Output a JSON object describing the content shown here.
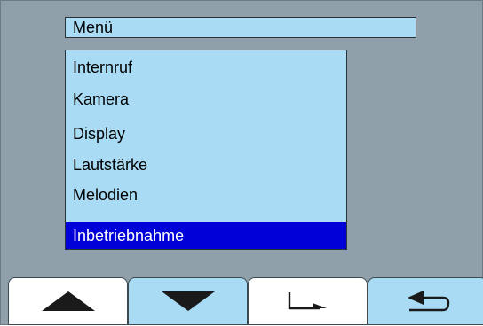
{
  "title": "Menü",
  "menu": {
    "items": [
      {
        "label": "Internruf",
        "selected": false
      },
      {
        "label": "Kamera",
        "selected": false
      },
      {
        "label": "Display",
        "selected": false
      },
      {
        "label": "Lautstärke",
        "selected": false
      },
      {
        "label": "Melodien",
        "selected": false
      },
      {
        "label": "Inbetriebnahme",
        "selected": true
      }
    ]
  },
  "softkeys": [
    {
      "icon": "arrow-up-icon"
    },
    {
      "icon": "arrow-down-icon"
    },
    {
      "icon": "enter-icon"
    },
    {
      "icon": "back-icon"
    }
  ],
  "colors": {
    "background": "#8fa0ab",
    "panel": "#a9dcf4",
    "selection": "#0000d8"
  }
}
